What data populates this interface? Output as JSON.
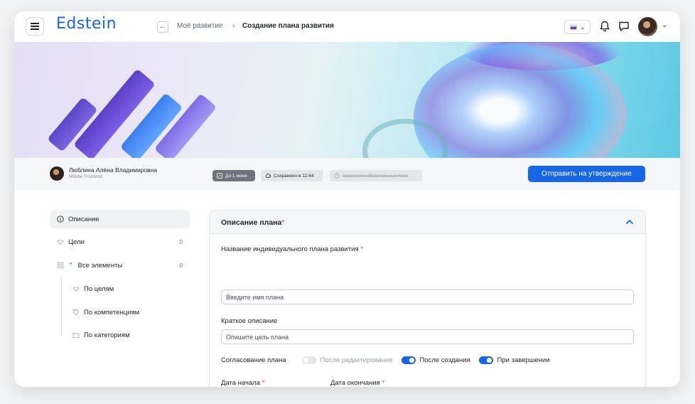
{
  "header": {
    "logo": "Edstein",
    "breadcrumb_parent": "Моё развитие",
    "breadcrumb_sep": "›",
    "breadcrumb_current": "Создание плана развития"
  },
  "profile": {
    "name": "Люблина Алёна Владимировна",
    "role": "Middle Frontend",
    "deadline_chip": "До 1 июня",
    "saved_chip": "Сохранено в 12:44",
    "required_chip": "Заполните обязательные поля",
    "submit_label": "Отправить на утверждение"
  },
  "sidebar": {
    "items": [
      {
        "label": "Описание",
        "icon": "info-icon"
      },
      {
        "label": "Цели",
        "icon": "diamond-icon",
        "count": "0"
      },
      {
        "label": "Все элементы",
        "icon": "grid-icon",
        "count": "0"
      }
    ],
    "sub_items": [
      {
        "label": "По целям",
        "icon": "diamond-icon"
      },
      {
        "label": "По компетенциям",
        "icon": "tag-icon"
      },
      {
        "label": "По категориям",
        "icon": "folder-icon"
      }
    ]
  },
  "form": {
    "title": "Описание плана",
    "required_mark": "*",
    "plan_name_label": "Название индивидуального плана развития",
    "plan_name_placeholder": "Введите имя плана",
    "short_desc_label": "Краткое описание",
    "short_desc_placeholder": "Опишите цель плана",
    "approval_label": "Согласование плана",
    "approval_options": [
      {
        "label": "После редактирования",
        "on": false
      },
      {
        "label": "После создания",
        "on": true
      },
      {
        "label": "При завершении",
        "on": true
      }
    ],
    "start_date_label": "Дата начала",
    "end_date_label": "Дата окончания"
  },
  "colors": {
    "accent": "#1766e6",
    "required": "#e0353b"
  }
}
